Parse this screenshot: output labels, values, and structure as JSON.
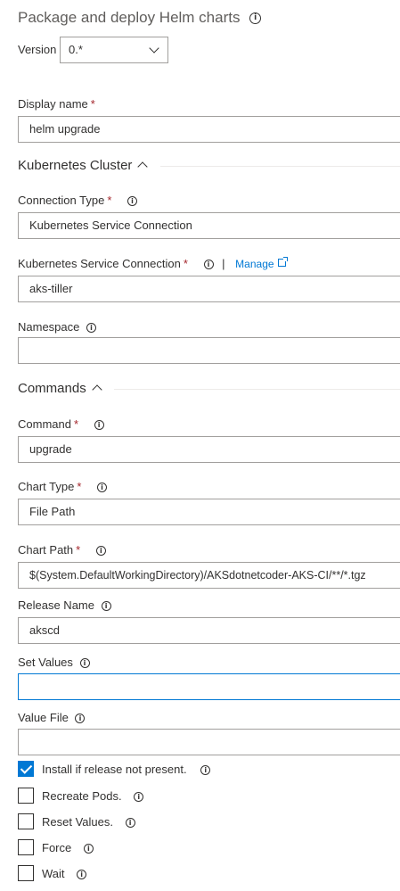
{
  "title": "Package and deploy Helm charts",
  "version": {
    "label": "Version",
    "value": "0.*"
  },
  "fields": {
    "display_name": {
      "label": "Display name",
      "value": "helm upgrade"
    },
    "connection_type": {
      "label": "Connection Type",
      "value": "Kubernetes Service Connection"
    },
    "k8s_service_connection": {
      "label": "Kubernetes Service Connection",
      "value": "aks-tiller",
      "separator": "|",
      "manage": "Manage"
    },
    "namespace": {
      "label": "Namespace",
      "value": ""
    },
    "command": {
      "label": "Command",
      "value": "upgrade"
    },
    "chart_type": {
      "label": "Chart Type",
      "value": "File Path"
    },
    "chart_path": {
      "label": "Chart Path",
      "value": "$(System.DefaultWorkingDirectory)/AKSdotnetcoder-AKS-CI/**/*.tgz"
    },
    "release_name": {
      "label": "Release Name",
      "value": "akscd"
    },
    "set_values": {
      "label": "Set Values",
      "value": ""
    },
    "value_file": {
      "label": "Value File",
      "value": ""
    }
  },
  "sections": {
    "cluster": "Kubernetes Cluster",
    "commands": "Commands"
  },
  "required_marker": "*",
  "checkboxes": [
    {
      "label": "Install if release not present.",
      "checked": true
    },
    {
      "label": "Recreate Pods.",
      "checked": false
    },
    {
      "label": "Reset Values.",
      "checked": false
    },
    {
      "label": "Force",
      "checked": false
    },
    {
      "label": "Wait",
      "checked": false
    }
  ]
}
